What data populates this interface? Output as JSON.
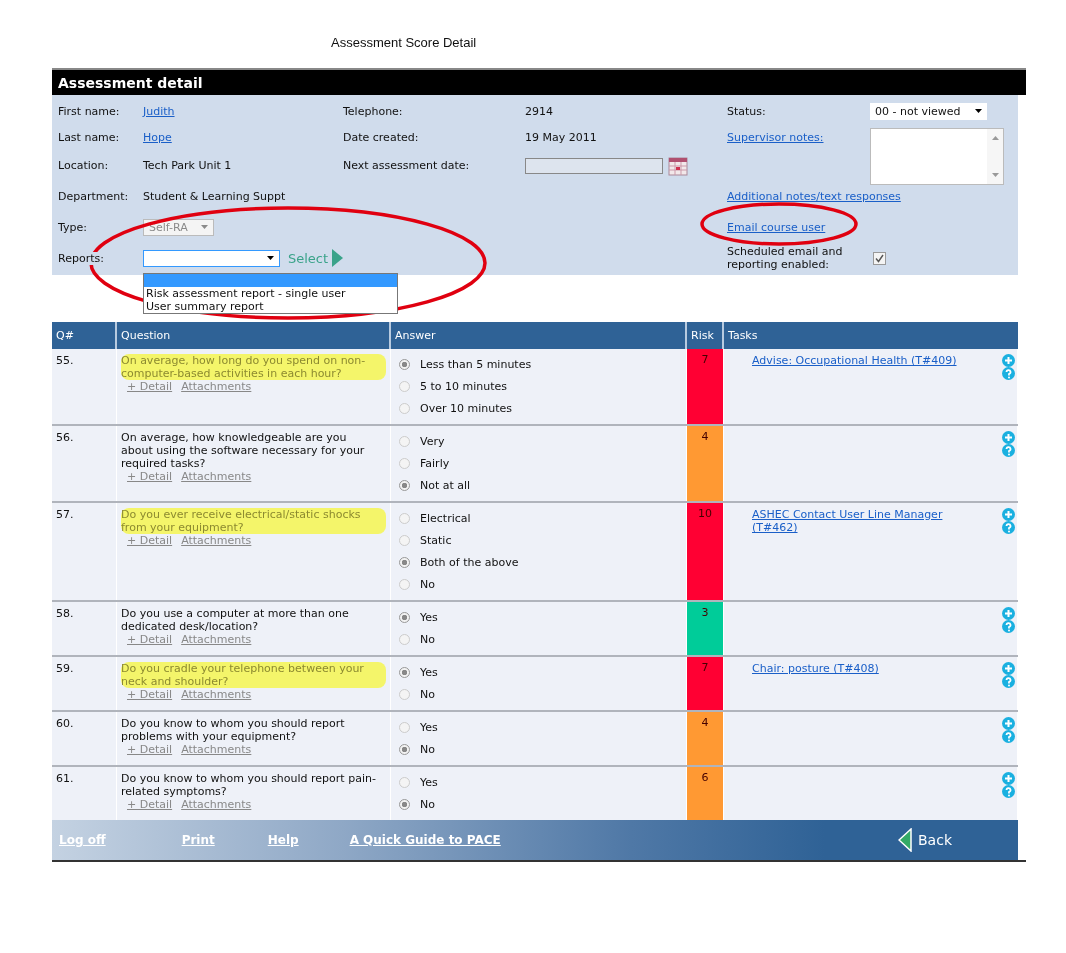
{
  "page_title": "Assessment Score Detail",
  "panel": {
    "title": "Assessment detail",
    "first_name": {
      "label": "First name:",
      "value": "Judith"
    },
    "last_name": {
      "label": "Last name:",
      "value": "Hope"
    },
    "location": {
      "label": "Location:",
      "value": "Tech Park Unit 1"
    },
    "department": {
      "label": "Department:",
      "value": "Student & Learning Suppt"
    },
    "type": {
      "label": "Type:",
      "value": "Self-RA",
      "disabled": true
    },
    "reports": {
      "label": "Reports:",
      "open": true,
      "button": "Select",
      "options": [
        {
          "label": "Risk assessment report - single user",
          "selected": false
        },
        {
          "label": "User summary report",
          "selected": false
        }
      ]
    },
    "telephone": {
      "label": "Telephone:",
      "value": "2914"
    },
    "date_created": {
      "label": "Date created:",
      "value": "19 May 2011"
    },
    "next_date": {
      "label": "Next assessment date:"
    },
    "status": {
      "label": "Status:",
      "value": "00 - not viewed"
    },
    "supervisor_notes": {
      "label": "Supervisor notes:"
    },
    "additional_notes": "Additional notes/text responses",
    "email_user": "Email course user",
    "scheduled": {
      "label": "Scheduled email and reporting enabled:",
      "checked": true
    }
  },
  "table": {
    "columns": [
      "Q#",
      "Question",
      "Answer",
      "Risk",
      "Tasks"
    ],
    "rows": [
      {
        "number": "55.",
        "question": "On average, how long do you spend on non-computer-based activities in each hour?",
        "highlighted": true,
        "answers": [
          {
            "label": "Less than 5 minutes",
            "selected": true
          },
          {
            "label": "5 to 10 minutes",
            "selected": false
          },
          {
            "label": "Over 10 minutes",
            "selected": false
          }
        ],
        "risk": "7",
        "color": "#ff0033",
        "task": "Advise: Occupational Health (T#409)"
      },
      {
        "number": "56.",
        "question": "On average, how knowledgeable are you about using the software necessary for your required tasks?",
        "highlighted": false,
        "answers": [
          {
            "label": "Very",
            "selected": false
          },
          {
            "label": "Fairly",
            "selected": false
          },
          {
            "label": "Not at all",
            "selected": true
          }
        ],
        "risk": "4",
        "color": "#ff9933"
      },
      {
        "number": "57.",
        "question": "Do you ever receive electrical/static shocks from your equipment?",
        "highlighted": true,
        "answers": [
          {
            "label": "Electrical",
            "selected": false
          },
          {
            "label": "Static",
            "selected": false
          },
          {
            "label": "Both of the above",
            "selected": true
          },
          {
            "label": "No",
            "selected": false
          }
        ],
        "risk": "10",
        "color": "#ff0033",
        "task": "ASHEC Contact User Line Manager (T#462)"
      },
      {
        "number": "58.",
        "question": "Do you use a computer at more than one dedicated desk/location?",
        "highlighted": false,
        "answers": [
          {
            "label": "Yes",
            "selected": true
          },
          {
            "label": "No",
            "selected": false
          }
        ],
        "risk": "3",
        "color": "#00cc99"
      },
      {
        "number": "59.",
        "question": "Do you cradle your telephone between your neck and shoulder?",
        "highlighted": true,
        "answers": [
          {
            "label": "Yes",
            "selected": true
          },
          {
            "label": "No",
            "selected": false
          }
        ],
        "risk": "7",
        "color": "#ff0033",
        "task": "Chair: posture (T#408)"
      },
      {
        "number": "60.",
        "question": "Do you know to whom you should report problems with your equipment?",
        "highlighted": false,
        "answers": [
          {
            "label": "Yes",
            "selected": false
          },
          {
            "label": "No",
            "selected": true
          }
        ],
        "risk": "4",
        "color": "#ff9933"
      },
      {
        "number": "61.",
        "question": "Do you know to whom you should report pain-related symptoms?",
        "highlighted": false,
        "answers": [
          {
            "label": "Yes",
            "selected": false
          },
          {
            "label": "No",
            "selected": true
          }
        ],
        "risk": "6",
        "color": "#ff9933"
      }
    ],
    "links": [
      [
        "+ Detail",
        "Attachments"
      ],
      [
        "+ Detail",
        "Attachments"
      ],
      [
        "+ Detail",
        "Attachments"
      ],
      [
        "+ Detail",
        "Attachments"
      ],
      [
        "+ Detail",
        "Attachments"
      ],
      [
        "+ Detail",
        "Attachments"
      ],
      [
        "+ Detail",
        "Attachments"
      ]
    ]
  },
  "footer": {
    "links": [
      "Log off",
      "Print",
      "Help",
      "A Quick Guide to PACE"
    ],
    "back": "Back"
  }
}
